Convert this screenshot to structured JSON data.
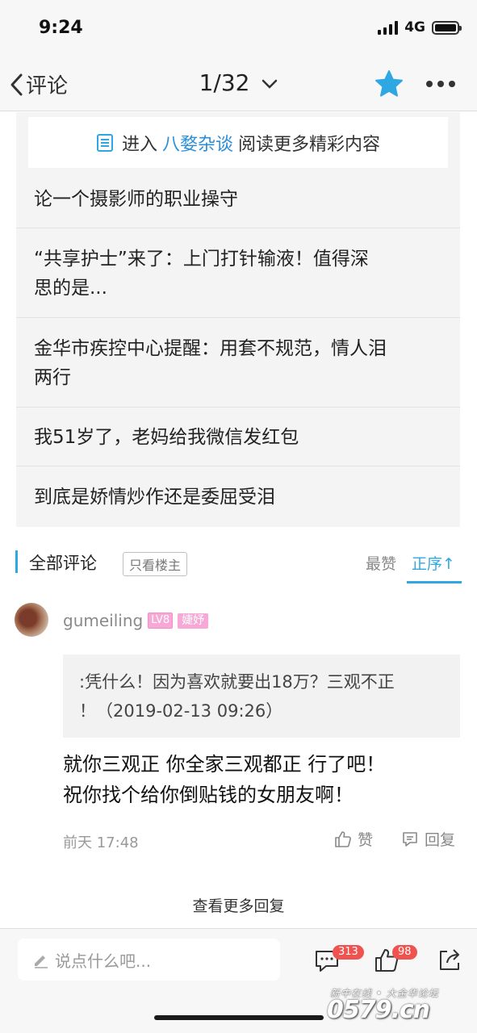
{
  "status_bar": {
    "time": "9:24",
    "network": "4G",
    "battery_level": 1.0
  },
  "nav": {
    "back_label": "评论",
    "page_indicator": "1/32"
  },
  "banner": {
    "prefix": "进入",
    "link": "八婺杂谈",
    "suffix": "阅读更多精彩内容"
  },
  "related": [
    {
      "title": "论一个摄影师的职业操守"
    },
    {
      "title_line1": "“共享护士”来了：上门打针输液！值得深",
      "title_line2": "思的是..."
    },
    {
      "title_line1": "金华市疾控中心提醒：用套不规范，情人泪",
      "title_line2": "两行"
    },
    {
      "title": "我51岁了，老妈给我微信发红包"
    },
    {
      "title": "到底是娇情炒作还是委屈受泪"
    }
  ],
  "comments_header": {
    "title": "全部评论",
    "filter": "只看楼主",
    "sort_hot": "最赞",
    "sort_order": "正序↑"
  },
  "comment": {
    "username": "gumeiling",
    "level": "LV8",
    "title_badge": "婕妤",
    "quote_line1": ":凭什么！因为喜欢就要出18万？三观不正",
    "quote_line2": "！（2019-02-13 09:26）",
    "body_line1": "就你三观正 你全家三观都正 行了吧！",
    "body_line2": "祝你找个给你倒贴钱的女朋友啊！",
    "time": "前天 17:48",
    "like_label": "赞",
    "reply_label": "回复"
  },
  "view_more": "查看更多回复",
  "bottom": {
    "input_placeholder": "说点什么吧...",
    "comment_count": "313",
    "like_count": "98"
  },
  "watermark": {
    "line1": "新中在线 • 大金华论坛",
    "line2": "0579.cn"
  },
  "colors": {
    "accent": "#2fa7e3",
    "badge": "#ef5350",
    "star": "#2fa7e3",
    "level_badge": "#f7a8d6"
  },
  "icons": [
    "chevron-left-icon",
    "chevron-down-icon",
    "star-icon",
    "more-icon",
    "document-icon",
    "thumbs-up-icon",
    "reply-icon",
    "edit-icon",
    "comment-icon",
    "share-icon"
  ]
}
